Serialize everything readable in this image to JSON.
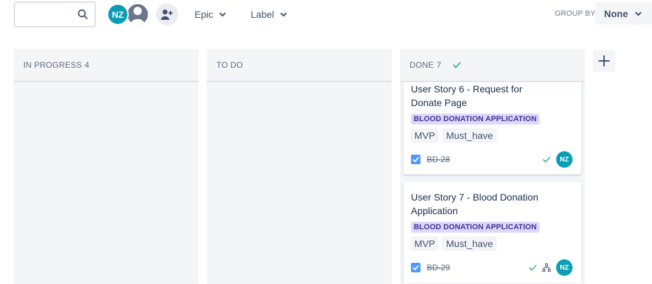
{
  "toolbar": {
    "search": {
      "value": "",
      "placeholder": ""
    },
    "user_avatar_initials": "NZ",
    "filters": [
      {
        "label": "Epic"
      },
      {
        "label": "Label"
      }
    ],
    "group_by": {
      "label": "GROUP BY",
      "value": "None"
    }
  },
  "columns": [
    {
      "name": "IN PROGRESS",
      "count": "4"
    },
    {
      "name": "TO DO",
      "count": ""
    },
    {
      "name": "DONE",
      "count": "7"
    }
  ],
  "cards": [
    {
      "title": "User Story 6 - Request for Donate Page",
      "epic": "BLOOD DONATION APPLICATION",
      "labels": [
        "MVP",
        "Must_have"
      ],
      "key": "BD-28",
      "assignee": "NZ"
    },
    {
      "title": "User Story 7 - Blood Donation Application",
      "epic": "BLOOD DONATION APPLICATION",
      "labels": [
        "MVP",
        "Must_have"
      ],
      "key": "BD-29",
      "assignee": "NZ"
    }
  ],
  "colors": {
    "accent": "#0a9eb5",
    "epic_bg": "#dfd8fd",
    "epic_text": "#403294",
    "done_green": "#36b37e",
    "checkbox_blue": "#4c9aff"
  },
  "icons": [
    "search-icon",
    "person-icon",
    "add-person-icon",
    "chevron-down-icon",
    "check-icon",
    "plus-icon",
    "hierarchy-icon"
  ]
}
